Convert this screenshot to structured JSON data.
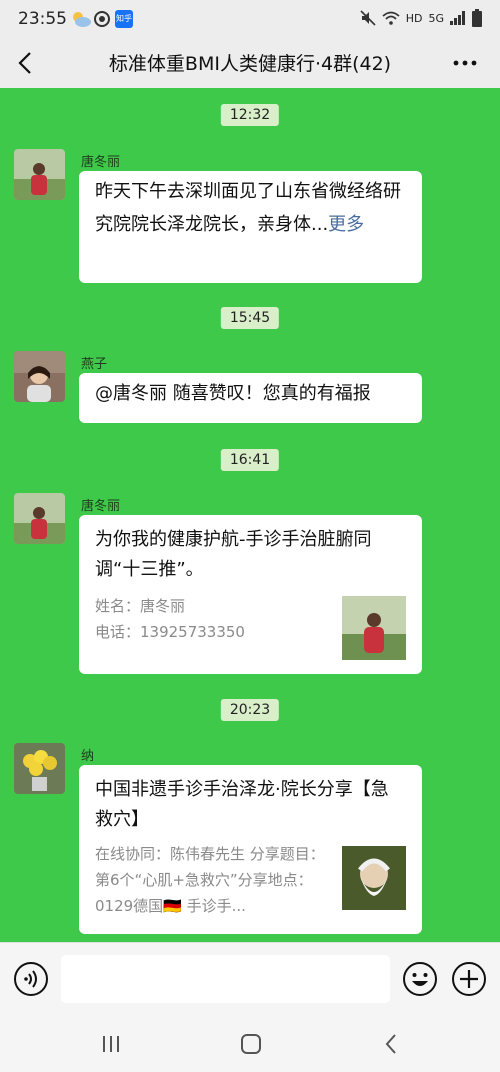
{
  "status": {
    "time": "23:55",
    "zhihu_label": "知乎",
    "hd": "HD",
    "network": "5G"
  },
  "header": {
    "title": "标准体重BMI人类健康行·4群(42)"
  },
  "messages": [
    {
      "time": "12:32",
      "sender": "唐冬丽",
      "text": "昨天下午去深圳面见了山东省微经络研究院院长泽龙院长，亲身体...",
      "more": "更多"
    },
    {
      "time": "15:45",
      "sender": "燕子",
      "text": "@唐冬丽  随喜赞叹！您真的有福报"
    },
    {
      "time": "16:41",
      "sender": "唐冬丽",
      "card_title": "为你我的健康护航-手诊手治脏腑同调“十三推”。",
      "card_desc": "姓名：唐冬丽\n电话：13925733350"
    },
    {
      "time": "20:23",
      "sender": "纳",
      "card_title": "中国非遗手诊手治泽龙·院长分享【急救穴】",
      "card_desc": "在线协同：陈伟春先生 分享题目：第6个“心肌+急救穴”分享地点：0129德国🇩🇪 手诊手..."
    }
  ],
  "icons": {
    "back": "back-arrow-icon",
    "more": "more-icon",
    "voice": "voice-icon",
    "emoji": "emoji-icon",
    "plus": "plus-icon"
  }
}
